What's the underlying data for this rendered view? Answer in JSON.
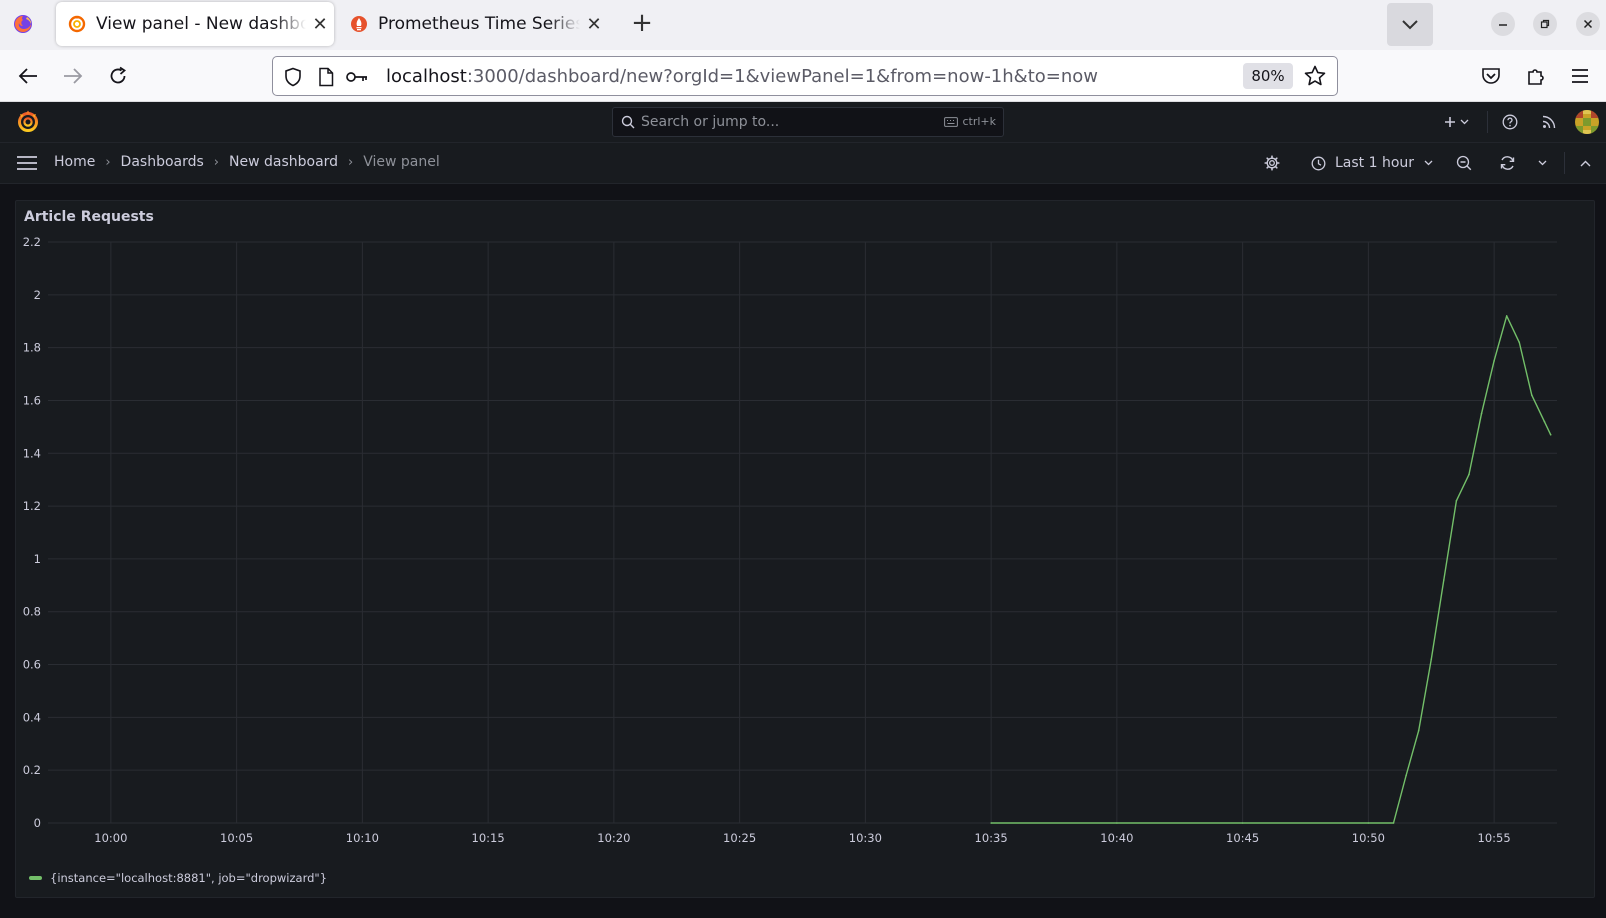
{
  "browser": {
    "tabs": [
      {
        "title": "View panel - New dashboard - Dashboards - Grafana",
        "active": true
      },
      {
        "title": "Prometheus Time Series Collection and Processing Server",
        "active": false
      }
    ],
    "url_host": "localhost",
    "url_rest": ":3000/dashboard/new?orgId=1&viewPanel=1&from=now-1h&to=now",
    "zoom": "80%"
  },
  "grafana": {
    "search_placeholder": "Search or jump to...",
    "search_shortcut": "ctrl+k",
    "breadcrumbs": [
      "Home",
      "Dashboards",
      "New dashboard",
      "View panel"
    ],
    "time_range": "Last 1 hour"
  },
  "panel": {
    "title": "Article Requests"
  },
  "colors": {
    "series": "#73bf69",
    "panel_bg": "#181b1f",
    "page_bg": "#111217",
    "grid": "#2a2d33",
    "text": "#ccccdc"
  },
  "chart_data": {
    "type": "line",
    "title": "Article Requests",
    "xlabel": "",
    "ylabel": "",
    "ylim": [
      0,
      2.2
    ],
    "yticks": [
      "0",
      "0.2",
      "0.4",
      "0.6",
      "0.8",
      "1",
      "1.2",
      "1.4",
      "1.6",
      "1.8",
      "2",
      "2.2"
    ],
    "xticks": [
      "10:00",
      "10:05",
      "10:10",
      "10:15",
      "10:20",
      "10:25",
      "10:30",
      "10:35",
      "10:40",
      "10:45",
      "10:50",
      "10:55"
    ],
    "xlim": [
      "09:57:30",
      "10:57:30"
    ],
    "grid": true,
    "legend_placement": "bottom-left",
    "series": [
      {
        "name": "{instance=\"localhost:8881\", job=\"dropwizard\"}",
        "color": "#73bf69",
        "x": [
          "10:35:00",
          "10:40:00",
          "10:45:00",
          "10:50:00",
          "10:51:00",
          "10:51:30",
          "10:52:00",
          "10:52:30",
          "10:53:00",
          "10:53:30",
          "10:54:00",
          "10:54:30",
          "10:55:00",
          "10:55:30",
          "10:56:00",
          "10:56:30",
          "10:57:00",
          "10:57:15"
        ],
        "values": [
          0,
          0,
          0,
          0,
          0,
          0.18,
          0.35,
          0.62,
          0.92,
          1.22,
          1.32,
          1.55,
          1.75,
          1.92,
          1.82,
          1.62,
          1.52,
          1.47
        ]
      }
    ]
  }
}
